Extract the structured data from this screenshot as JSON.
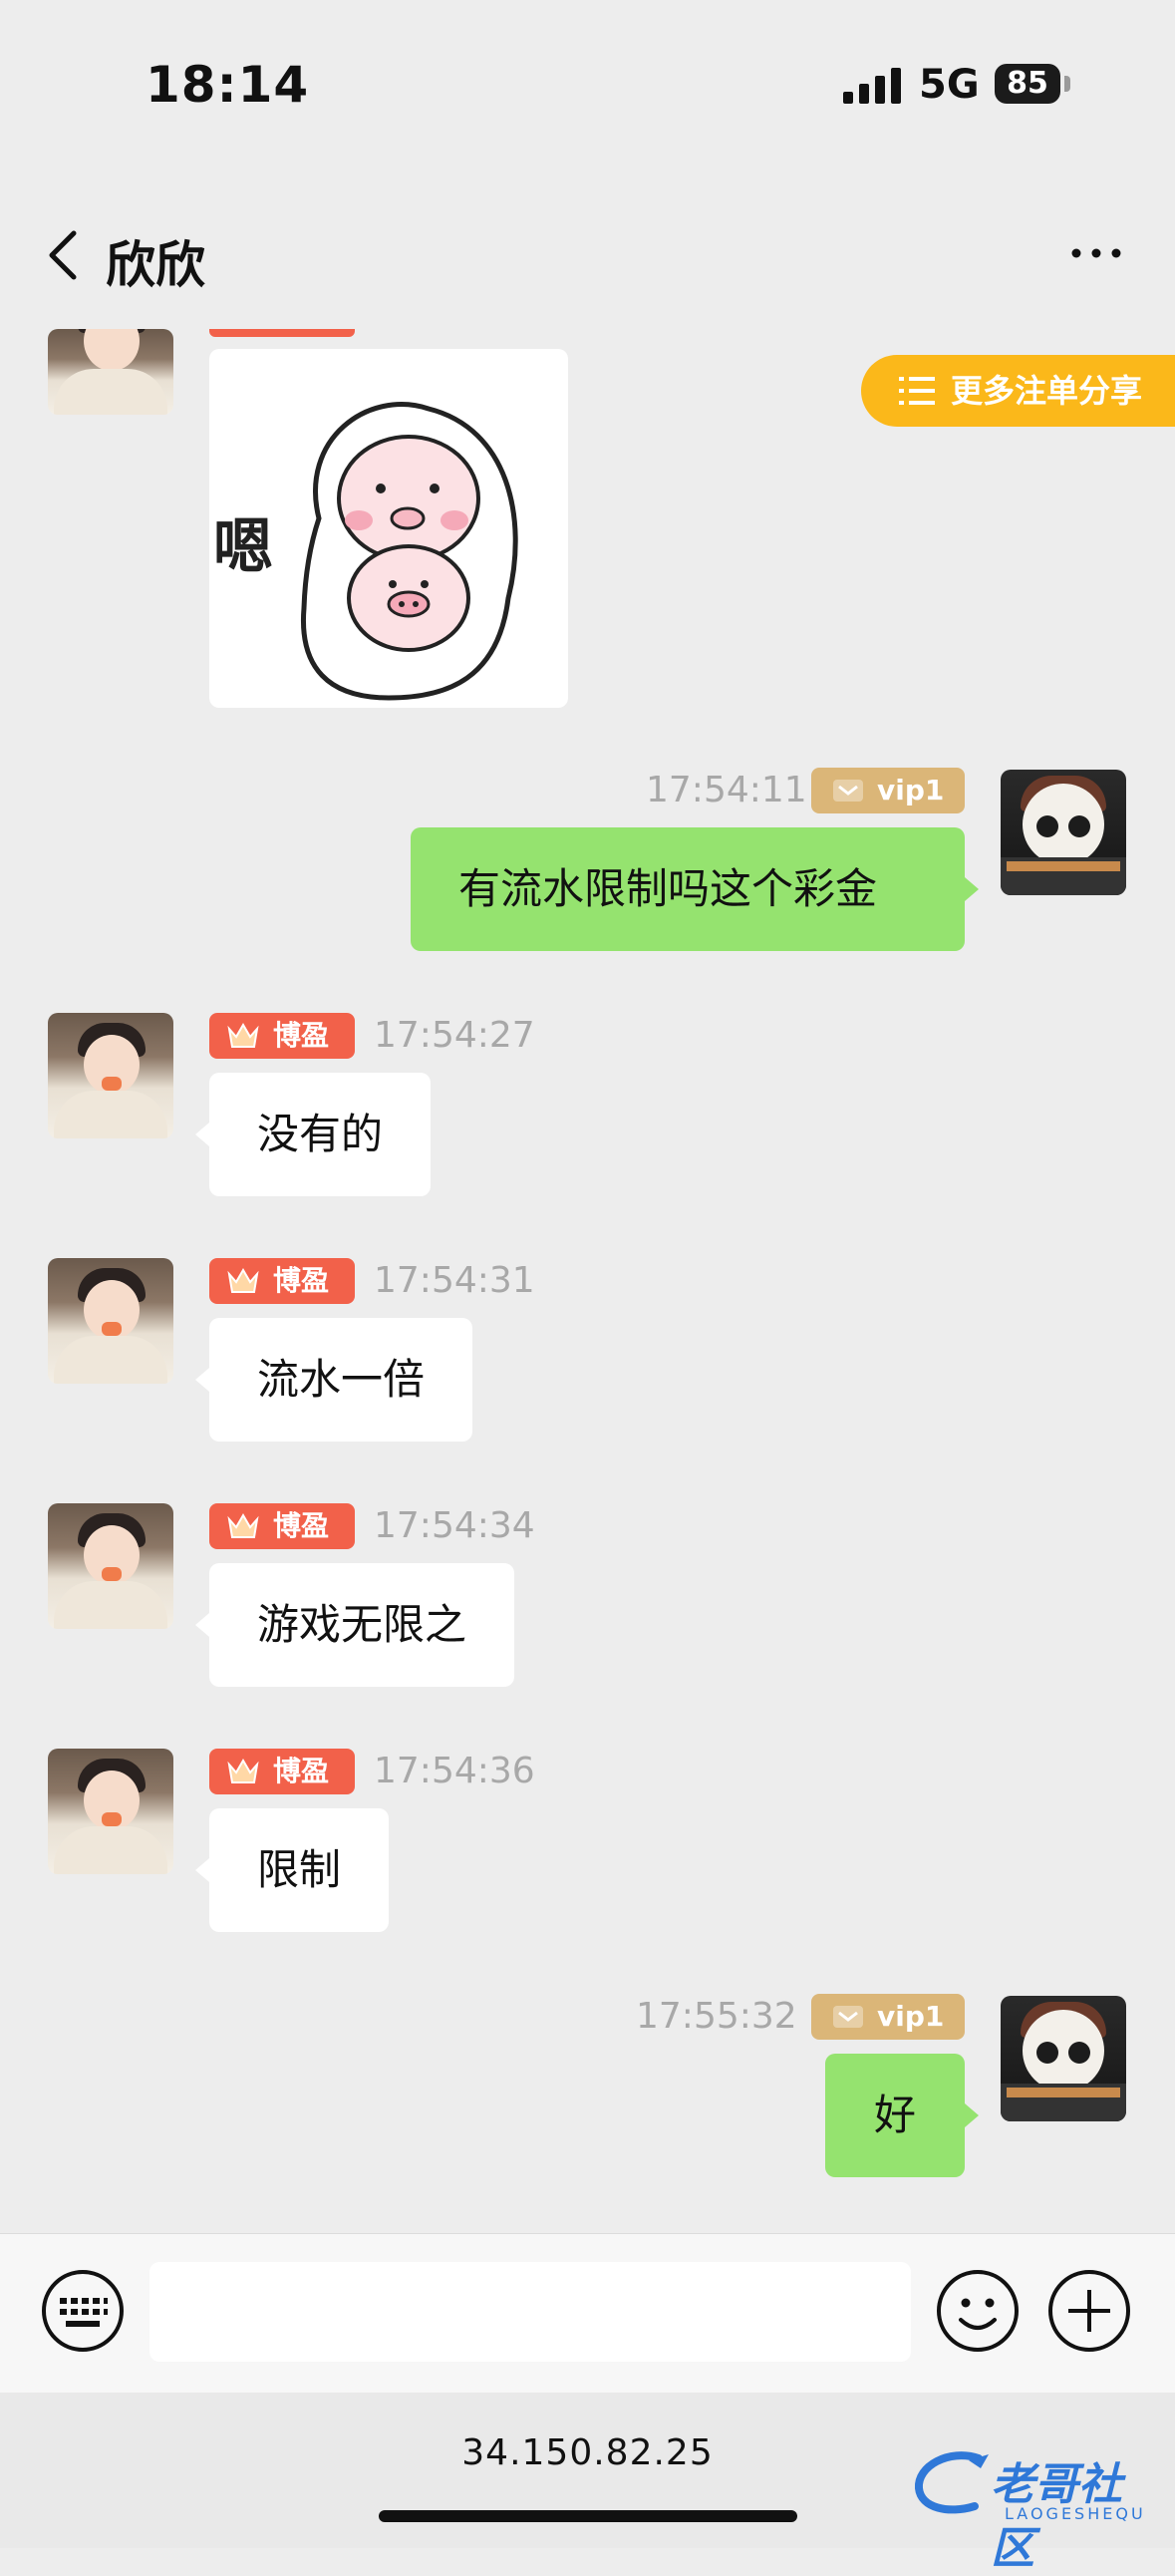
{
  "status": {
    "time": "18:14",
    "network": "5G",
    "battery": "85"
  },
  "nav": {
    "title": "欣欣"
  },
  "more_share": {
    "label": "更多注单分享"
  },
  "messages": [
    {
      "side": "out",
      "time": "17:54:11",
      "vip": "vip1",
      "text": "有流水限制吗这个彩金"
    },
    {
      "side": "in",
      "badge": "博盈",
      "time": "17:54:27",
      "text": "没有的"
    },
    {
      "side": "in",
      "badge": "博盈",
      "time": "17:54:31",
      "text": "流水一倍"
    },
    {
      "side": "in",
      "badge": "博盈",
      "time": "17:54:34",
      "text": "游戏无限之"
    },
    {
      "side": "in",
      "badge": "博盈",
      "time": "17:54:36",
      "text": "限制"
    },
    {
      "side": "out",
      "time": "17:55:32",
      "vip": "vip1",
      "text": "好"
    }
  ],
  "sticker": {
    "text": "嗯"
  },
  "url": "34.150.82.25",
  "watermark": {
    "title": "老哥社区",
    "subtitle": "LAOGESHEQU"
  },
  "colors": {
    "out_bubble": "#95e36f",
    "badge": "#f2614a",
    "vip": "#dbb678",
    "share": "#fbb81a"
  }
}
